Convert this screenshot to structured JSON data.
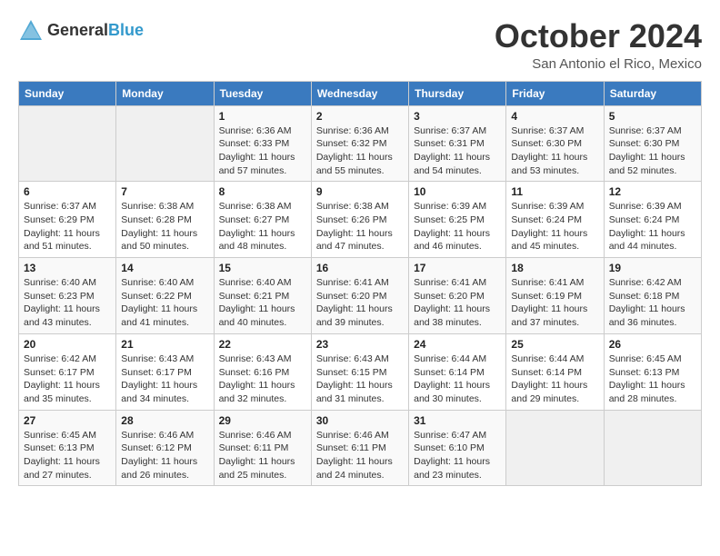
{
  "header": {
    "logo_general": "General",
    "logo_blue": "Blue",
    "month_title": "October 2024",
    "location": "San Antonio el Rico, Mexico"
  },
  "days_of_week": [
    "Sunday",
    "Monday",
    "Tuesday",
    "Wednesday",
    "Thursday",
    "Friday",
    "Saturday"
  ],
  "weeks": [
    [
      {
        "day": "",
        "info": ""
      },
      {
        "day": "",
        "info": ""
      },
      {
        "day": "1",
        "info": "Sunrise: 6:36 AM\nSunset: 6:33 PM\nDaylight: 11 hours and 57 minutes."
      },
      {
        "day": "2",
        "info": "Sunrise: 6:36 AM\nSunset: 6:32 PM\nDaylight: 11 hours and 55 minutes."
      },
      {
        "day": "3",
        "info": "Sunrise: 6:37 AM\nSunset: 6:31 PM\nDaylight: 11 hours and 54 minutes."
      },
      {
        "day": "4",
        "info": "Sunrise: 6:37 AM\nSunset: 6:30 PM\nDaylight: 11 hours and 53 minutes."
      },
      {
        "day": "5",
        "info": "Sunrise: 6:37 AM\nSunset: 6:30 PM\nDaylight: 11 hours and 52 minutes."
      }
    ],
    [
      {
        "day": "6",
        "info": "Sunrise: 6:37 AM\nSunset: 6:29 PM\nDaylight: 11 hours and 51 minutes."
      },
      {
        "day": "7",
        "info": "Sunrise: 6:38 AM\nSunset: 6:28 PM\nDaylight: 11 hours and 50 minutes."
      },
      {
        "day": "8",
        "info": "Sunrise: 6:38 AM\nSunset: 6:27 PM\nDaylight: 11 hours and 48 minutes."
      },
      {
        "day": "9",
        "info": "Sunrise: 6:38 AM\nSunset: 6:26 PM\nDaylight: 11 hours and 47 minutes."
      },
      {
        "day": "10",
        "info": "Sunrise: 6:39 AM\nSunset: 6:25 PM\nDaylight: 11 hours and 46 minutes."
      },
      {
        "day": "11",
        "info": "Sunrise: 6:39 AM\nSunset: 6:24 PM\nDaylight: 11 hours and 45 minutes."
      },
      {
        "day": "12",
        "info": "Sunrise: 6:39 AM\nSunset: 6:24 PM\nDaylight: 11 hours and 44 minutes."
      }
    ],
    [
      {
        "day": "13",
        "info": "Sunrise: 6:40 AM\nSunset: 6:23 PM\nDaylight: 11 hours and 43 minutes."
      },
      {
        "day": "14",
        "info": "Sunrise: 6:40 AM\nSunset: 6:22 PM\nDaylight: 11 hours and 41 minutes."
      },
      {
        "day": "15",
        "info": "Sunrise: 6:40 AM\nSunset: 6:21 PM\nDaylight: 11 hours and 40 minutes."
      },
      {
        "day": "16",
        "info": "Sunrise: 6:41 AM\nSunset: 6:20 PM\nDaylight: 11 hours and 39 minutes."
      },
      {
        "day": "17",
        "info": "Sunrise: 6:41 AM\nSunset: 6:20 PM\nDaylight: 11 hours and 38 minutes."
      },
      {
        "day": "18",
        "info": "Sunrise: 6:41 AM\nSunset: 6:19 PM\nDaylight: 11 hours and 37 minutes."
      },
      {
        "day": "19",
        "info": "Sunrise: 6:42 AM\nSunset: 6:18 PM\nDaylight: 11 hours and 36 minutes."
      }
    ],
    [
      {
        "day": "20",
        "info": "Sunrise: 6:42 AM\nSunset: 6:17 PM\nDaylight: 11 hours and 35 minutes."
      },
      {
        "day": "21",
        "info": "Sunrise: 6:43 AM\nSunset: 6:17 PM\nDaylight: 11 hours and 34 minutes."
      },
      {
        "day": "22",
        "info": "Sunrise: 6:43 AM\nSunset: 6:16 PM\nDaylight: 11 hours and 32 minutes."
      },
      {
        "day": "23",
        "info": "Sunrise: 6:43 AM\nSunset: 6:15 PM\nDaylight: 11 hours and 31 minutes."
      },
      {
        "day": "24",
        "info": "Sunrise: 6:44 AM\nSunset: 6:14 PM\nDaylight: 11 hours and 30 minutes."
      },
      {
        "day": "25",
        "info": "Sunrise: 6:44 AM\nSunset: 6:14 PM\nDaylight: 11 hours and 29 minutes."
      },
      {
        "day": "26",
        "info": "Sunrise: 6:45 AM\nSunset: 6:13 PM\nDaylight: 11 hours and 28 minutes."
      }
    ],
    [
      {
        "day": "27",
        "info": "Sunrise: 6:45 AM\nSunset: 6:13 PM\nDaylight: 11 hours and 27 minutes."
      },
      {
        "day": "28",
        "info": "Sunrise: 6:46 AM\nSunset: 6:12 PM\nDaylight: 11 hours and 26 minutes."
      },
      {
        "day": "29",
        "info": "Sunrise: 6:46 AM\nSunset: 6:11 PM\nDaylight: 11 hours and 25 minutes."
      },
      {
        "day": "30",
        "info": "Sunrise: 6:46 AM\nSunset: 6:11 PM\nDaylight: 11 hours and 24 minutes."
      },
      {
        "day": "31",
        "info": "Sunrise: 6:47 AM\nSunset: 6:10 PM\nDaylight: 11 hours and 23 minutes."
      },
      {
        "day": "",
        "info": ""
      },
      {
        "day": "",
        "info": ""
      }
    ]
  ]
}
